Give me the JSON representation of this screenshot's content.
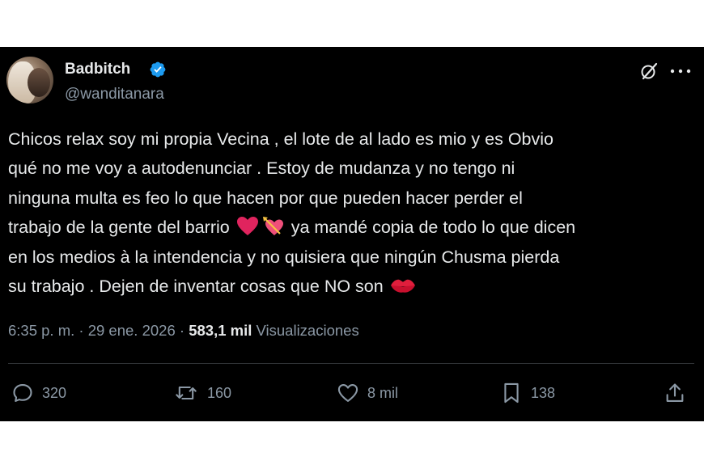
{
  "user": {
    "display_name": "Badbitch",
    "handle": "@wanditanara",
    "verified": true,
    "verified_color": "#1d9bf0"
  },
  "header_icons": [
    "grok-icon",
    "more-options-icon"
  ],
  "tweet": {
    "lines": [
      "Chicos relax soy mi propia Vecina , el lote de al lado es mio y es Obvio",
      "qué no me voy a autodenunciar . Estoy de mudanza y no tengo ni",
      "ninguna multa es feo lo que hacen por que pueden hacer perder el",
      "trabajo de la gente del barrio",
      "ya mandé copia de todo lo que dicen",
      "en los medios à la intendencia  y no quisiera que ningún Chusma pierda",
      "su trabajo . Dejen de inventar cosas que NO son"
    ],
    "emojis": [
      "red-heart-icon",
      "heart-with-arrow-icon",
      "kiss-mark-icon"
    ]
  },
  "meta": {
    "time": "6:35 p. m.",
    "separator": "·",
    "date": "29 ene. 2026",
    "views_count": "583,1 mil",
    "views_label": "Visualizaciones"
  },
  "actions": {
    "replies": "320",
    "reposts": "160",
    "likes": "8 mil",
    "bookmarks": "138"
  },
  "colors": {
    "background": "#000000",
    "text": "#e7e9ea",
    "secondary_text": "#8b98a5",
    "divider": "#2f3336"
  }
}
